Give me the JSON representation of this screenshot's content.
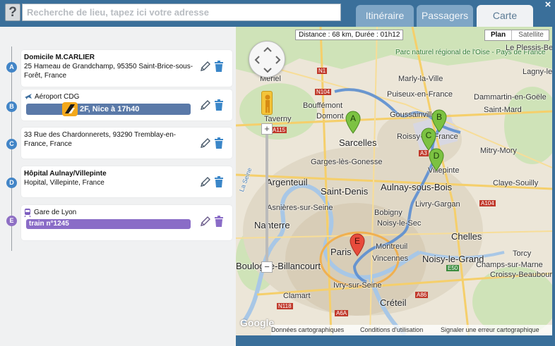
{
  "search": {
    "placeholder": "Recherche de lieu, tapez ici votre adresse"
  },
  "help": {
    "label": "?"
  },
  "tabs": [
    {
      "label": "Itinéraire"
    },
    {
      "label": "Passagers"
    },
    {
      "label": "Carte"
    }
  ],
  "close": {
    "label": "×"
  },
  "stops": [
    {
      "marker": "A",
      "title": "Domicile M.CARLIER",
      "address": "25 Hameau de Grandchamp, 95350 Saint-Brice-sous-Forêt, France"
    },
    {
      "marker": "B",
      "title": "Aéroport CDG",
      "icon": "plane-icon",
      "transport": "2F, Nice à 17h40"
    },
    {
      "marker": "C",
      "title": "",
      "address": "33 Rue des Chardonnerets, 93290 Tremblay-en-France, France"
    },
    {
      "marker": "D",
      "title": "Hôpital Aulnay/Villepinte",
      "address": "Hopital, Villepinte, France"
    },
    {
      "marker": "E",
      "title": "Gare de Lyon",
      "icon": "train-icon",
      "transport": "train n°1245"
    }
  ],
  "map": {
    "distance": "Distance : 68 km, Durée : 01h12",
    "maptype": {
      "plan": "Plan",
      "satellite": "Satellite"
    },
    "zoom_in": "+",
    "zoom_out": "−",
    "logo": "Google",
    "footer": {
      "data": "Données cartographiques",
      "terms": "Conditions d'utilisation",
      "report": "Signaler une erreur cartographique"
    },
    "labels": {
      "meriel": "Mériel",
      "parc": "Parc naturel régional de l'Oise - Pays de France",
      "marly": "Marly-la-Ville",
      "plessis": "Le Plessis-Belleville",
      "lagny": "Lagny-le-Sec",
      "puiseux": "Puiseux-en-France",
      "dammartin": "Dammartin-en-Goële",
      "bouffemont": "Bouffémont",
      "domont": "Domont",
      "goussainville": "Goussainville",
      "saintmard": "Saint-Mard",
      "taverny": "Taverny",
      "roissy": "Roissy-en-France",
      "mitry": "Mitry-Mory",
      "sarcelles": "Sarcelles",
      "garges": "Garges-lès-Gonesse",
      "villepinte": "Villepinte",
      "argenteuil": "Argenteuil",
      "saintdenis": "Saint-Denis",
      "aulnay": "Aulnay-sous-Bois",
      "claye": "Claye-Souilly",
      "asnieres": "Asnières-sur-Seine",
      "livry": "Livry-Gargan",
      "bobigny": "Bobigny",
      "nanterre": "Nanterre",
      "noisysec": "Noisy-le-Sec",
      "chelles": "Chelles",
      "paris": "Paris",
      "montreuil": "Montreuil",
      "vincennes": "Vincennes",
      "noisygrand": "Noisy-le-Grand",
      "boulogne": "Boulogne-Billancourt",
      "ivry": "Ivry-sur-Seine",
      "clamart": "Clamart",
      "creteil": "Créteil",
      "champs": "Champs-sur-Marne",
      "torcy": "Torcy",
      "croissy": "Croissy-Beaubourg",
      "seine": "La Seine",
      "r_n1": "N1",
      "r_n104": "N104",
      "r_a115": "A115",
      "r_a3": "A3",
      "r_a104": "A104",
      "r_e50": "E50",
      "r_n118": "N118",
      "r_a6a": "A6A",
      "r_a86": "A86"
    }
  }
}
